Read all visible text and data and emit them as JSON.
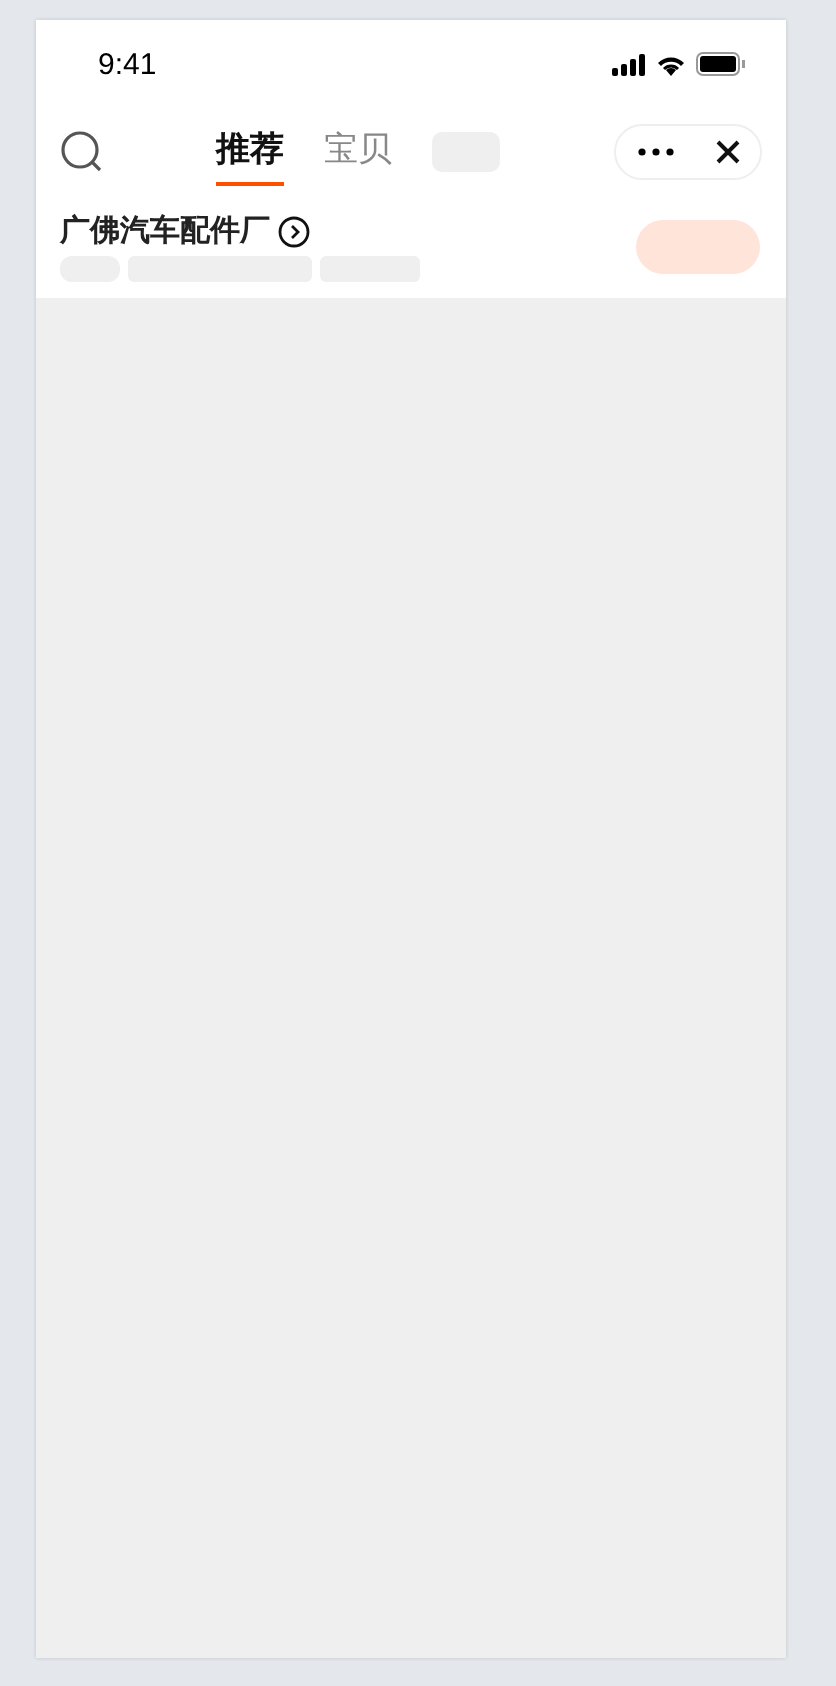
{
  "status_bar": {
    "time": "9:41"
  },
  "tabs": [
    {
      "kind": "text",
      "label": "推荐",
      "selected": true
    },
    {
      "kind": "text",
      "label": "宝贝",
      "selected": false
    },
    {
      "kind": "loading",
      "selected": false
    }
  ],
  "shop": {
    "name": "广佛汽车配件厂"
  }
}
